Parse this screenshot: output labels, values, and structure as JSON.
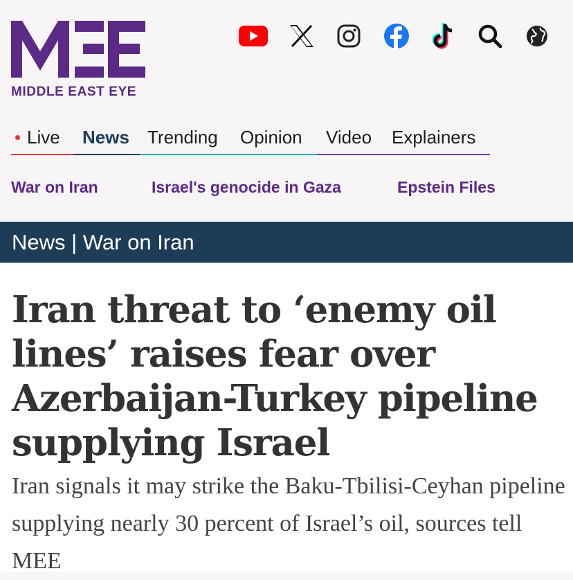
{
  "brand": {
    "logo_mark": "MEE",
    "logo_text": "MIDDLE EAST EYE",
    "color": "#5b2a86"
  },
  "social_icons": [
    {
      "name": "youtube-icon",
      "color": "#ff0000"
    },
    {
      "name": "x-icon",
      "color": "#111111"
    },
    {
      "name": "instagram-icon",
      "color": "#222222"
    },
    {
      "name": "facebook-icon",
      "color": "#1877f2"
    },
    {
      "name": "tiktok-icon",
      "color": "#111111"
    },
    {
      "name": "search-icon",
      "color": "#111111"
    },
    {
      "name": "globe-icon",
      "color": "#222222"
    }
  ],
  "nav": {
    "items": [
      {
        "label": "Live",
        "bar_color": "#e0363f"
      },
      {
        "label": "News",
        "bar_color": "#1d3c58"
      },
      {
        "label": "Trending",
        "bar_color": "#2bb0b0"
      },
      {
        "label": "Opinion",
        "bar_color": "#2bb0b0"
      },
      {
        "label": "Video",
        "bar_color": "#7b3f9e"
      },
      {
        "label": "Explainers",
        "bar_color": "#7b3f9e"
      }
    ],
    "active": "News"
  },
  "subnav": {
    "items": [
      "War on Iran",
      "Israel's genocide in Gaza",
      "Epstein Files"
    ]
  },
  "section": {
    "label": "News | War on Iran",
    "background": "#1d3c58"
  },
  "article": {
    "headline": "Iran threat to ‘enemy oil lines’ raises fear over Azerbaijan-Turkey pipeline supplying Israel",
    "standfirst": "Iran signals it may strike the Baku-Tbilisi-Ceyhan pipeline supplying nearly 30 percent of Israel’s oil, sources tell MEE"
  }
}
